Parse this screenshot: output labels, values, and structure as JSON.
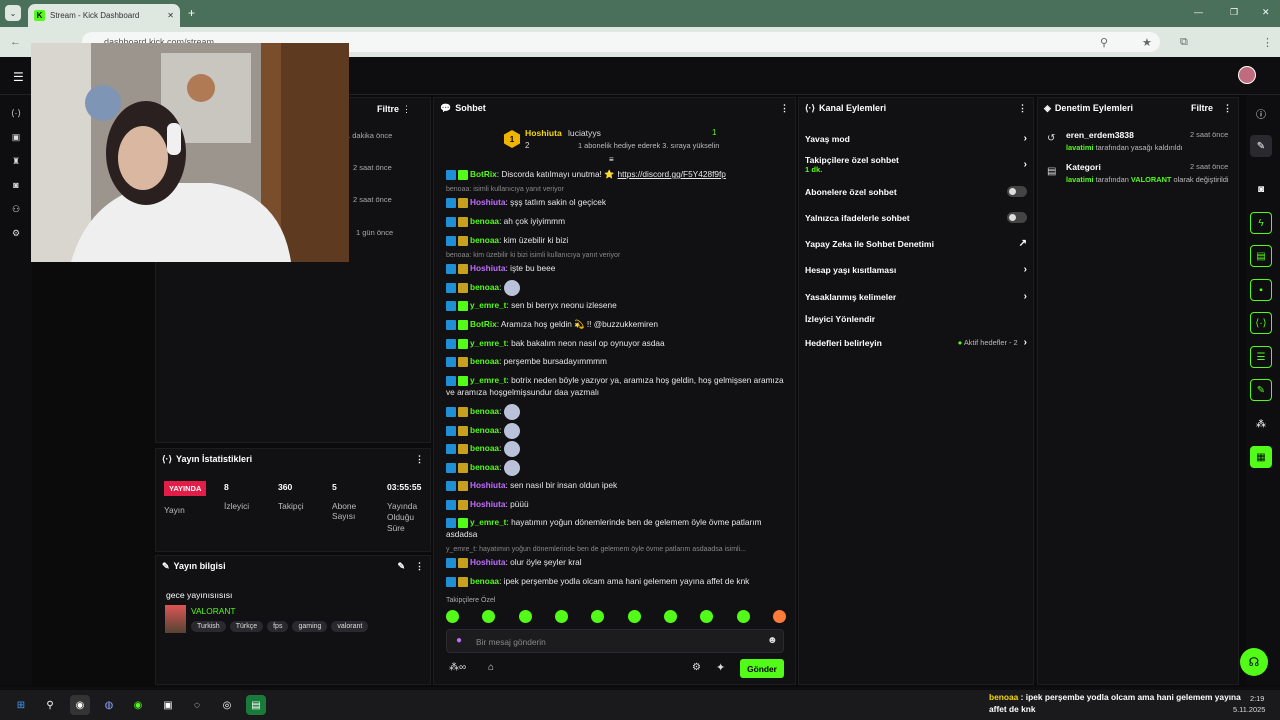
{
  "browser": {
    "tab_title": "Stream - Kick Dashboard",
    "url": "dashboard.kick.com/stream"
  },
  "mod_actions_left": {
    "filter_label": "Filtre",
    "times": [
      "1 dakika önce",
      "2 saat önce",
      "2 saat önce",
      "1 gün önce"
    ]
  },
  "chat": {
    "title": "Sohbet",
    "top_gifter": {
      "name": "Hoshiuta",
      "count": "2",
      "rank": "1"
    },
    "gift_user": {
      "name": "luciatyys",
      "count": "1",
      "note": "1 abonelik hediye ederek 3. sıraya yükselin"
    },
    "messages": [
      {
        "user": "BotRix",
        "text": ": Discorda katılmayı unutma! ⭐",
        "link": "https://discord.gg/F5Y428f9fp",
        "color": "green"
      },
      {
        "reply": "benoaa: isimli kullanıcıya yanıt veriyor"
      },
      {
        "user": "Hoshiuta",
        "text": ": şşş tatlım sakin ol geçicek",
        "color": "purple"
      },
      {
        "user": "benoaa",
        "text": ": ah çok iyiyimmm",
        "color": "lime"
      },
      {
        "user": "benoaa",
        "text": ": kim üzebilir ki bizi",
        "color": "lime"
      },
      {
        "reply": "benoaa: kim üzebilir ki bizi isimli kullanıcıya yanıt veriyor"
      },
      {
        "user": "Hoshiuta",
        "text": ": işte bu beee",
        "color": "purple"
      },
      {
        "user": "benoaa",
        "text": ":",
        "color": "lime",
        "emote": true
      },
      {
        "user": "y_emre_t",
        "text": ": sen bi berryx neonu izlesene",
        "color": "green"
      },
      {
        "user": "BotRix",
        "text": ": Aramıza hoş geldin 💫 !! @buzzukkemiren",
        "color": "green"
      },
      {
        "user": "y_emre_t",
        "text": ": bak bakalım neon nasıl op oynuyor asdaa",
        "color": "green"
      },
      {
        "user": "benoaa",
        "text": ": perşembe bursadayımmmm",
        "color": "lime"
      },
      {
        "user": "y_emre_t",
        "text": ": botrix neden böyle yazıyor ya, aramıza hoş geldin, hoş gelmişsen aramıza ve aramıza hoşgelmişsundur daa yazmalı",
        "color": "green"
      },
      {
        "user": "benoaa",
        "text": ":",
        "color": "lime",
        "emote": true
      },
      {
        "user": "benoaa",
        "text": ":",
        "color": "lime",
        "emote": true
      },
      {
        "user": "benoaa",
        "text": ":",
        "color": "lime",
        "emote": true
      },
      {
        "user": "benoaa",
        "text": ":",
        "color": "lime",
        "emote": true
      },
      {
        "user": "Hoshiuta",
        "text": ": sen nasıl bir insan oldun ipek",
        "color": "purple"
      },
      {
        "user": "Hoshiuta",
        "text": ": püüü",
        "color": "purple"
      },
      {
        "user": "y_emre_t",
        "text": ": hayatımın yoğun dönemlerinde ben de gelemem öyle övme patlarım asdadsa",
        "color": "green"
      },
      {
        "reply": "y_emre_t: hayatımın yoğun dönemlerinde ben de gelemem öyle övme patlarım asdaadsa isimli..."
      },
      {
        "user": "Hoshiuta",
        "text": ": olur öyle şeyler kral",
        "color": "purple"
      },
      {
        "user": "benoaa",
        "text": ": ipek perşembe yodla olcam ama hani gelemem yayına affet de knk",
        "color": "lime"
      }
    ],
    "followers_only": "Takipçilere Özel",
    "input_placeholder": "Bir mesaj gönderin",
    "send_label": "Gönder"
  },
  "stats": {
    "title": "Yayın İstatistikleri",
    "live_badge": "YAYINDA",
    "items": [
      {
        "value": "",
        "label": "Yayın"
      },
      {
        "value": "8",
        "label": "İzleyici"
      },
      {
        "value": "360",
        "label": "Takipçi"
      },
      {
        "value": "5",
        "label": "Abone Sayısı"
      },
      {
        "value": "03:55:55",
        "label": "Yayında Olduğu Süre"
      }
    ]
  },
  "stream_info": {
    "title": "Yayın bilgisi",
    "stream_title": "gece yayınısıısısı",
    "category": "VALORANT",
    "tags": [
      "Turkish",
      "Türkçe",
      "fps",
      "gaming",
      "valorant"
    ]
  },
  "channel_actions": {
    "title": "Kanal Eylemleri",
    "rows": [
      {
        "label": "Yavaş mod",
        "kind": "arrow"
      },
      {
        "label": "Takipçilere özel sohbet",
        "sub": "1 dk.",
        "kind": "arrow"
      },
      {
        "label": "Abonelere özel sohbet",
        "kind": "toggle"
      },
      {
        "label": "Yalnızca ifadelerle sohbet",
        "kind": "toggle"
      },
      {
        "label": "Yapay Zeka ile Sohbet Denetimi",
        "kind": "ext"
      },
      {
        "label": "Hesap yaşı kısıtlaması",
        "kind": "arrow"
      },
      {
        "label": "Yasaklanmış kelimeler",
        "kind": "arrow"
      },
      {
        "label": "İzleyici Yönlendir",
        "kind": "none"
      },
      {
        "label": "Hedefleri belirleyin",
        "kind": "goal",
        "extra": "Aktif hedefler - 2"
      }
    ]
  },
  "mod_actions": {
    "title": "Denetim Eylemleri",
    "filter": "Filtre",
    "items": [
      {
        "name": "eren_erdem3838",
        "actor": "lavatimi",
        "desc": " tarafından yasağı kaldırıldı",
        "time": "2 saat önce"
      },
      {
        "name": "Kategori",
        "actor": "lavatimi",
        "desc": " tarafından ",
        "cat": "VALORANT",
        "desc2": " olarak değiştirildi",
        "time": "2 saat önce"
      }
    ]
  },
  "taskbar": {
    "ticker_user": "benoaa",
    "ticker_text": " : ipek perşembe yodla olcam ama hani gelemem yayına affet de knk",
    "clock": "2:19",
    "date": "5.11.2025"
  }
}
